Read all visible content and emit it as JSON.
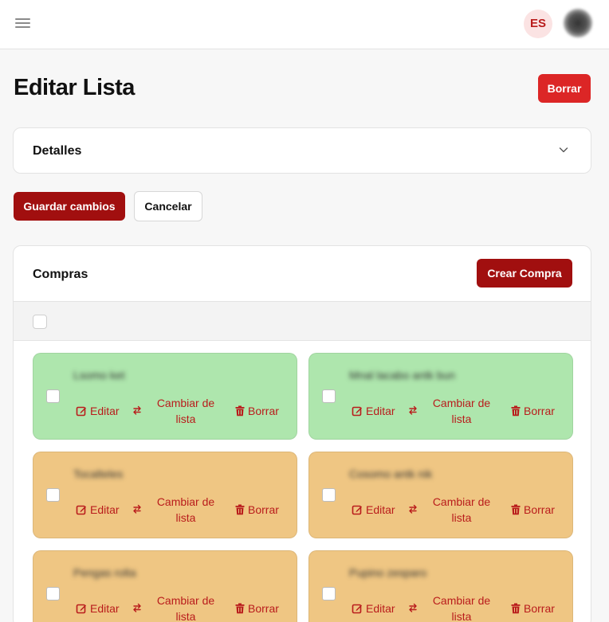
{
  "header": {
    "language": "ES"
  },
  "page": {
    "title": "Editar Lista",
    "delete_label": "Borrar"
  },
  "details": {
    "title": "Detalles"
  },
  "actions": {
    "save_label": "Guardar cambios",
    "cancel_label": "Cancelar"
  },
  "purchases": {
    "title": "Compras",
    "create_label": "Crear Compra",
    "items": [
      {
        "name": "Lsomo ket",
        "status": "green",
        "edit_label": "Editar",
        "move_label": "Cambiar de lista",
        "delete_label": "Borrar"
      },
      {
        "name": "Mnal lacabo antk bun",
        "status": "green",
        "edit_label": "Editar",
        "move_label": "Cambiar de lista",
        "delete_label": "Borrar"
      },
      {
        "name": "Tocalteles",
        "status": "orange",
        "edit_label": "Editar",
        "move_label": "Cambiar de lista",
        "delete_label": "Borrar"
      },
      {
        "name": "Cosomo antk nik",
        "status": "orange",
        "edit_label": "Editar",
        "move_label": "Cambiar de lista",
        "delete_label": "Borrar"
      },
      {
        "name": "Pengas rolta",
        "status": "orange",
        "edit_label": "Editar",
        "move_label": "Cambiar de lista",
        "delete_label": "Borrar"
      },
      {
        "name": "Pupino zesparo",
        "status": "orange",
        "edit_label": "Editar",
        "move_label": "Cambiar de lista",
        "delete_label": "Borrar"
      }
    ]
  },
  "colors": {
    "accent": "#dc2626",
    "accent_dark": "#a10f0f",
    "status_green": "#aee6ad",
    "status_orange": "#efc683"
  }
}
